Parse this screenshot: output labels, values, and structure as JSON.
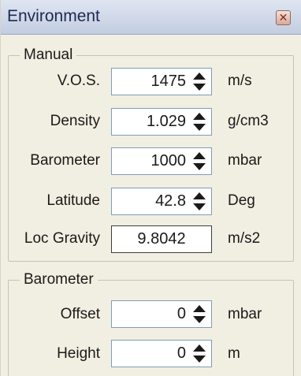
{
  "window": {
    "title": "Environment",
    "close_icon": "close-icon"
  },
  "manual": {
    "legend": "Manual",
    "rows": [
      {
        "label": "V.O.S.",
        "value": "1475",
        "unit": "m/s"
      },
      {
        "label": "Density",
        "value": "1.029",
        "unit": "g/cm3"
      },
      {
        "label": "Barometer",
        "value": "1000",
        "unit": "mbar"
      },
      {
        "label": "Latitude",
        "value": "42.8",
        "unit": "Deg"
      },
      {
        "label": "Loc Gravity",
        "value": "9.8042",
        "unit": "m/s2"
      }
    ]
  },
  "barometer": {
    "legend": "Barometer",
    "rows": [
      {
        "label": "Offset",
        "value": "0",
        "unit": "mbar"
      },
      {
        "label": "Height",
        "value": "0",
        "unit": "m"
      }
    ]
  }
}
